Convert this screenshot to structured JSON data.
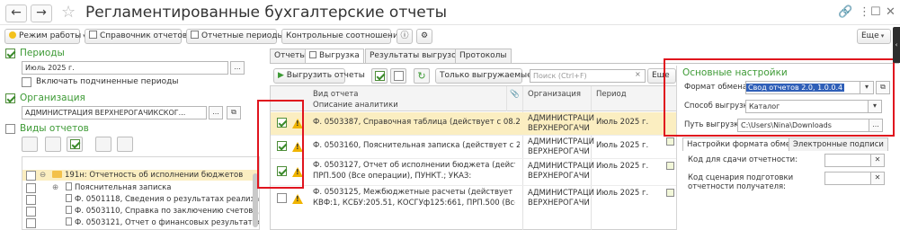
{
  "window": {
    "title": "Регламентированные бухгалтерские отчеты"
  },
  "toolbar": {
    "mode": "Режим работы",
    "directory": "Справочник отчетов",
    "periods": "Отчетные периоды",
    "control": "Контрольные соотношения",
    "more": "Еще"
  },
  "left": {
    "periods_label": "Периоды",
    "period_value": "Июль 2025 г.",
    "include_sub": "Включать подчиненные периоды",
    "org_label": "Организация",
    "org_value": "АДМИНИСТРАЦИЯ ВЕРХНЕРОГАЧИКСКОГ...",
    "types_label": "Виды отчетов",
    "tree": [
      {
        "text": "191н: Отчетность об исполнении бюджетов"
      },
      {
        "text": "Пояснительная записка"
      },
      {
        "text": "Ф. 0501118, Сведения о результатах реализац..."
      },
      {
        "text": "Ф. 0503110, Справка по заключению счетов (де..."
      },
      {
        "text": "Ф. 0503121, Отчет о финансовых результатах (..."
      }
    ]
  },
  "tabs": [
    "Отчеты",
    "Выгрузка",
    "Результаты выгрузок",
    "Протоколы"
  ],
  "export_toolbar": {
    "export_btn": "Выгрузить отчеты",
    "only_exported": "Только выгружаемые",
    "search_placeholder": "Поиск (Ctrl+F)",
    "more": "Еще"
  },
  "grid": {
    "headers": {
      "type": "Вид отчета",
      "desc": "Описание аналитики",
      "org": "Организация",
      "period": "Период"
    },
    "rows": [
      {
        "type": "Ф. 0503387, Справочная таблица (действует с 08.2024)",
        "desc": "",
        "org1": "АДМИНИСТРАЦИ",
        "org2": "ВЕРХНЕРОГАЧИ",
        "period": "Июль 2025 г.",
        "checked": true
      },
      {
        "type": "Ф. 0503160, Пояснительная записка (действует с 2018)",
        "desc": "",
        "org1": "АДМИНИСТРАЦИ",
        "org2": "ВЕРХНЕРОГАЧИ",
        "period": "Июль 2025 г.",
        "checked": true
      },
      {
        "type": "Ф. 0503127, Отчет об исполнении бюджета (действуе...",
        "desc": "ПРП.500 (Все операции), ПУНКТ.; УКАЗ:",
        "org1": "АДМИНИСТРАЦИ",
        "org2": "ВЕРХНЕРОГАЧИ",
        "period": "Июль 2025 г.",
        "checked": true
      },
      {
        "type": "Ф. 0503125, Межбюджетные расчеты (действует с 201...",
        "desc": "КВФ:1, КСБУ:205.51, КОСГУф125:661, ПРП.500 (Все опера...",
        "org1": "АДМИНИСТРАЦИ",
        "org2": "ВЕРХНЕРОГАЧИ",
        "period": "Июль 2025 г.",
        "checked": false
      }
    ]
  },
  "settings": {
    "heading": "Основные настройки",
    "format_label": "Формат обмена:",
    "format_value": "Свод отчетов 2.0, 1.0.0.4",
    "method_label": "Способ выгрузки:",
    "method_value": "Каталог",
    "path_label": "Путь выгрузки:",
    "path_value": "C:\\Users\\Nina\\Downloads",
    "tab_format": "Настройки формата обме...",
    "tab_sign": "Электронные подписи",
    "code_label": "Код для сдачи отчетности:",
    "scenario_label": "Код сценария подготовки отчетности получателя:"
  },
  "colors": {
    "accent": "#3d9a35",
    "highlight_red": "#e0141e",
    "selected_row": "#fbeec1"
  }
}
